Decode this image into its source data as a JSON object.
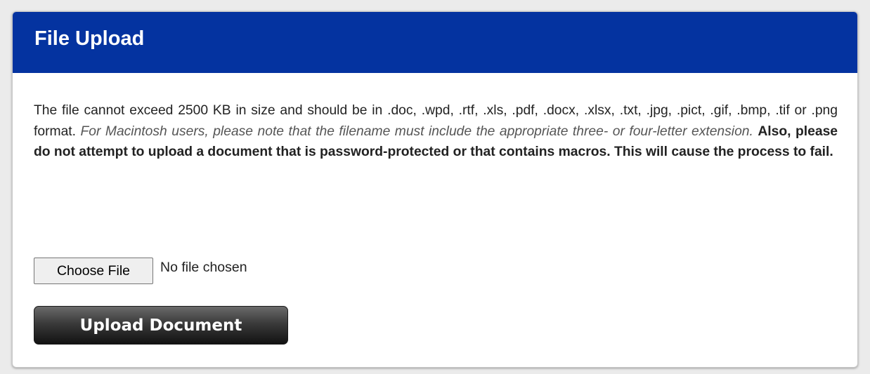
{
  "panel": {
    "title": "File Upload"
  },
  "instructions": {
    "normal": "The file cannot exceed 2500 KB in size and should be in .doc, .wpd, .rtf, .xls, .pdf, .docx, .xlsx, .txt, .jpg, .pict, .gif, .bmp, .tif or .png format.",
    "italic": "For Macintosh users, please note that the filename must include the appropriate three- or four-letter extension.",
    "bold": "Also, please do not attempt to upload a document that is password-protected or that contains macros. This will cause the process to fail."
  },
  "file_input": {
    "button_label": "Choose File",
    "status": "No file chosen"
  },
  "upload_button": {
    "label": "Upload Document"
  },
  "colors": {
    "header_background": "#0433a0",
    "page_background": "#ebebeb",
    "upload_button": "#2b2b2b"
  }
}
